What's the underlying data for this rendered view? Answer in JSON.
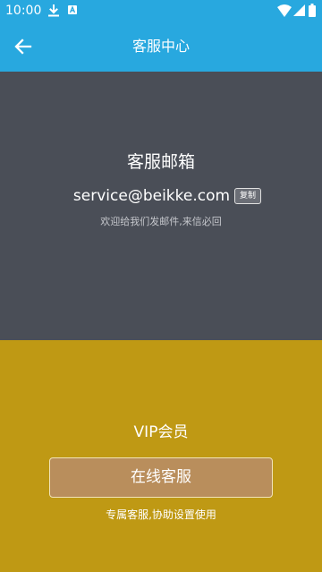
{
  "status_bar": {
    "time": "10:00",
    "icons": [
      "download-icon",
      "a-notification-icon",
      "wifi-icon",
      "signal-icon",
      "battery-icon"
    ]
  },
  "app_bar": {
    "title": "客服中心",
    "back_icon": "arrow-left-icon"
  },
  "email_section": {
    "heading": "客服邮箱",
    "email": "service@beikke.com",
    "copy_label": "复制",
    "note": "欢迎给我们发邮件,来信必回"
  },
  "vip_section": {
    "heading": "VIP会员",
    "button_label": "在线客服",
    "note": "专属客服,协助设置使用"
  },
  "colors": {
    "primary_blue": "#28a8df",
    "email_background": "#4a4e57",
    "vip_background": "#bf9914",
    "button_background": "#b98e5c"
  }
}
